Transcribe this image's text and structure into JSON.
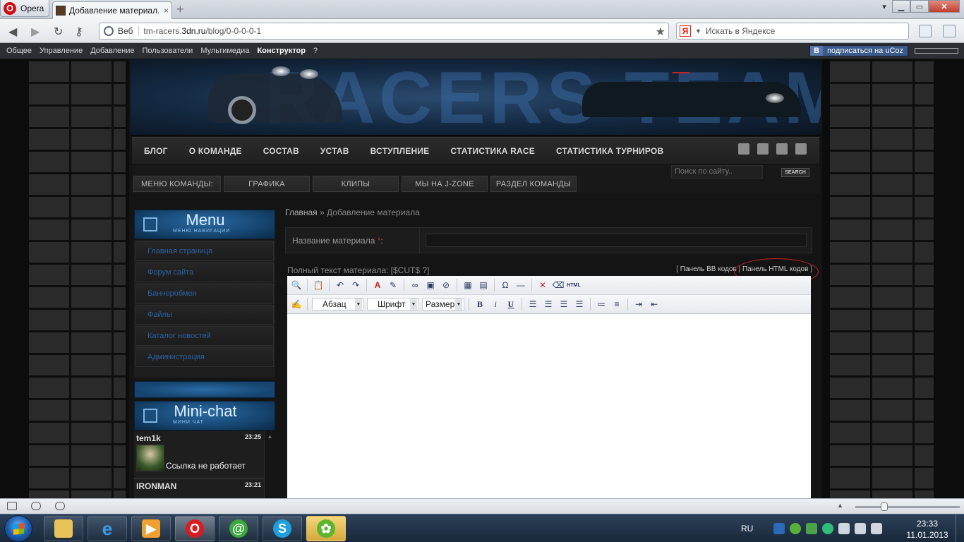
{
  "browser": {
    "menu_label": "Opera",
    "tab_title": "Добавление материал...",
    "tab_close": "×",
    "new_tab": "+",
    "web_label": "Веб",
    "url_host_pre": "tm-racers.",
    "url_host_main": "3dn.ru",
    "url_path": "/blog/0-0-0-0-1",
    "search_placeholder": "Искать в Яндексе",
    "search_engine_icon": "Я"
  },
  "ucoz_bar": {
    "items": [
      "Общее",
      "Управление",
      "Добавление",
      "Пользователи",
      "Мультимедиа"
    ],
    "active_item": "Конструктор",
    "help": "?",
    "subscribe_icon": "B",
    "subscribe_label": "подписаться на uCoz"
  },
  "site": {
    "main_nav": [
      "БЛОГ",
      "О КОМАНДЕ",
      "СОСТАВ",
      "УСТАВ",
      "ВСТУПЛЕНИЕ",
      "СТАТИСТИКА RACE",
      "СТАТИСТИКА ТУРНИРОВ"
    ],
    "search_placeholder": "Поиск по сайту..",
    "search_button": "SEARCH",
    "team_menu": [
      "МЕНЮ КОМАНДЫ:",
      "ГРАФИКА",
      "КЛИПЫ",
      "МЫ НА J-ZONE",
      "РАЗДЕЛ КОМАНДЫ"
    ],
    "menu_block": {
      "title": "Menu",
      "subtitle": "МЕНЮ НАВИГАЦИИ"
    },
    "side_menu": [
      "Главная страница",
      "Форум сайта",
      "Баннеробмен",
      "Файлы",
      "Каталог новостей",
      "Администрация"
    ],
    "minichat_block": {
      "title": "Mini-chat",
      "subtitle": "МИНИ ЧАТ"
    },
    "chat_messages": [
      {
        "nick": "tem1k",
        "time": "23:25",
        "text": "Ссылка не работает"
      },
      {
        "nick": "IRONMAN",
        "time": "23:21",
        "text": ""
      }
    ]
  },
  "content": {
    "breadcrumb_home": "Главная",
    "breadcrumb_sep": " » ",
    "breadcrumb_current": "Добавление материала",
    "title_label": "Название материала",
    "required_mark": "*",
    "title_colon": ":",
    "fulltext_label": "Полный текст материала: [$CUT$ ?]",
    "bb_panel": "Панель BB кодов",
    "html_panel": "Панель HTML кодов",
    "editor": {
      "paragraph_select": "Абзац",
      "font_select": "Шрифт",
      "size_select": "Размер"
    }
  },
  "taskbar": {
    "lang": "RU",
    "time": "23:33",
    "date": "11.01.2013"
  },
  "colors": {
    "accent_blue": "#2a62a0",
    "red_annotation": "#d12020"
  }
}
